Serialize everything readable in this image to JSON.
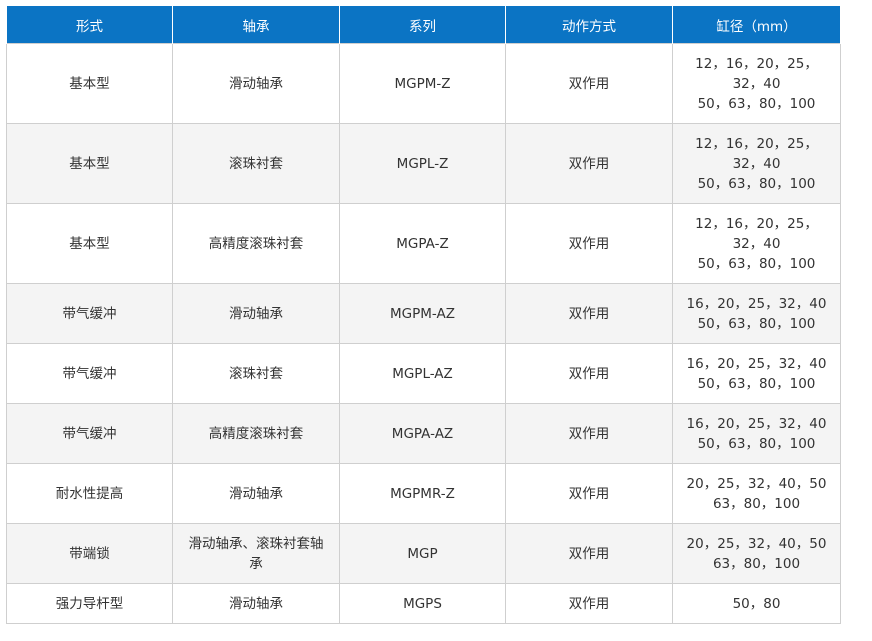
{
  "headers": [
    "形式",
    "轴承",
    "系列",
    "动作方式",
    "缸径（mm）"
  ],
  "rows": [
    {
      "form": "基本型",
      "bearing": [
        "滑动轴承"
      ],
      "series": "MGPM-Z",
      "action": "双作用",
      "bore": [
        "12，16，20，25，",
        "32，40",
        "50，63，80，100"
      ]
    },
    {
      "form": "基本型",
      "bearing": [
        "滚珠衬套"
      ],
      "series": "MGPL-Z",
      "action": "双作用",
      "bore": [
        "12，16，20，25，",
        "32，40",
        "50，63，80，100"
      ]
    },
    {
      "form": "基本型",
      "bearing": [
        "高精度滚珠衬套"
      ],
      "series": "MGPA-Z",
      "action": "双作用",
      "bore": [
        "12，16，20，25，",
        "32，40",
        "50，63，80，100"
      ]
    },
    {
      "form": "带气缓冲",
      "bearing": [
        "滑动轴承"
      ],
      "series": "MGPM-AZ",
      "action": "双作用",
      "bore": [
        "16，20，25，32，40",
        "50，63，80，100"
      ]
    },
    {
      "form": "带气缓冲",
      "bearing": [
        "滚珠衬套"
      ],
      "series": "MGPL-AZ",
      "action": "双作用",
      "bore": [
        "16，20，25，32，40",
        "50，63，80，100"
      ]
    },
    {
      "form": "带气缓冲",
      "bearing": [
        "高精度滚珠衬套"
      ],
      "series": "MGPA-AZ",
      "action": "双作用",
      "bore": [
        "16，20，25，32，40",
        "50，63，80，100"
      ]
    },
    {
      "form": "耐水性提高",
      "bearing": [
        "滑动轴承"
      ],
      "series": "MGPMR-Z",
      "action": "双作用",
      "bore": [
        "20，25，32，40，50",
        "63，80，100"
      ]
    },
    {
      "form": "带端锁",
      "bearing": [
        "滑动轴承、滚珠衬套轴",
        "承"
      ],
      "series": "MGP",
      "action": "双作用",
      "bore": [
        "20，25，32，40，50",
        "63，80，100"
      ]
    },
    {
      "form": "强力导杆型",
      "bearing": [
        "滑动轴承"
      ],
      "series": "MGPS",
      "action": "双作用",
      "bore": [
        "50，80"
      ]
    }
  ],
  "colors": {
    "header_bg": "#0b74c4",
    "header_text": "#ffffff",
    "row_alt_bg": "#f4f4f4",
    "border": "#cfcfcf",
    "body_text": "#333333"
  }
}
